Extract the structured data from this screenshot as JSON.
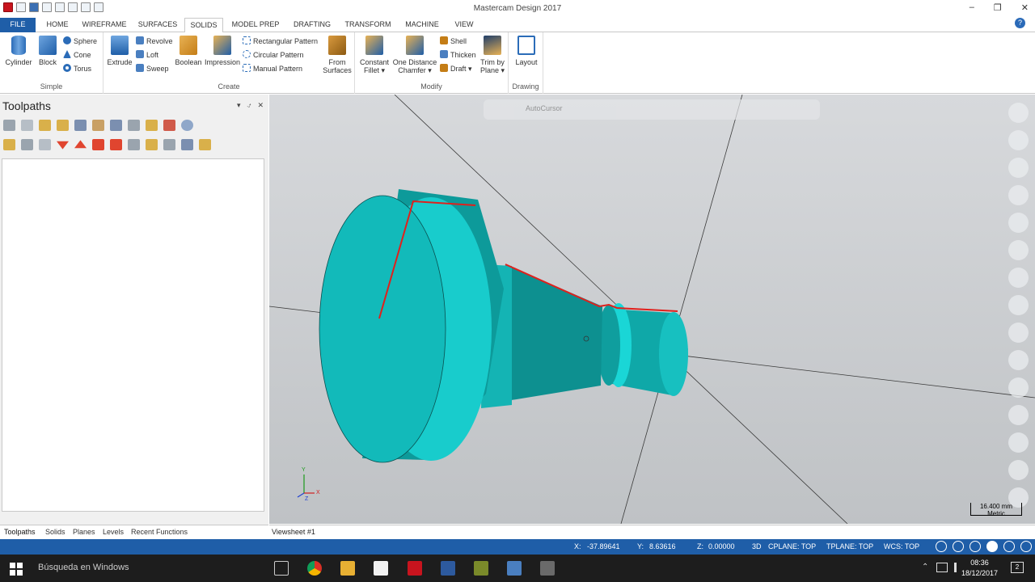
{
  "window": {
    "title": "Mastercam Design 2017"
  },
  "ribbon_tabs": [
    "FILE",
    "HOME",
    "WIREFRAME",
    "SURFACES",
    "SOLIDS",
    "MODEL PREP",
    "DRAFTING",
    "TRANSFORM",
    "MACHINE",
    "VIEW"
  ],
  "ribbon": {
    "simple": {
      "label": "Simple",
      "cylinder": "Cylinder",
      "block": "Block",
      "sphere": "Sphere",
      "cone": "Cone",
      "torus": "Torus"
    },
    "create": {
      "label": "Create",
      "extrude": "Extrude",
      "revolve": "Revolve",
      "loft": "Loft",
      "sweep": "Sweep",
      "boolean": "Boolean",
      "impression": "Impression",
      "rect_pattern": "Rectangular Pattern",
      "circ_pattern": "Circular Pattern",
      "manual_pattern": "Manual Pattern",
      "from_surfaces_1": "From",
      "from_surfaces_2": "Surfaces"
    },
    "modify": {
      "label": "Modify",
      "constant_fillet_1": "Constant",
      "constant_fillet_2": "Fillet",
      "one_distance_1": "One Distance",
      "one_distance_2": "Chamfer",
      "shell": "Shell",
      "thicken": "Thicken",
      "draft": "Draft",
      "trim_1": "Trim by",
      "trim_2": "Plane"
    },
    "drawing": {
      "label": "Drawing",
      "layout": "Layout"
    }
  },
  "toolpaths_panel": {
    "title": "Toolpaths"
  },
  "bottom_tabs": [
    "Toolpaths",
    "Solids",
    "Planes",
    "Levels",
    "Recent Functions"
  ],
  "viewsheet": "Viewsheet #1",
  "viewport": {
    "autocursor": "AutoCursor",
    "scale_value": "16.400 mm",
    "scale_unit": "Metric",
    "axis_y": "Y",
    "axis_x": "X",
    "axis_z": "Z"
  },
  "status": {
    "x_label": "X:",
    "x": "-37.89641",
    "y_label": "Y:",
    "y": "8.63616",
    "z_label": "Z:",
    "z": "0.00000",
    "mode": "3D",
    "cplane": "CPLANE: TOP",
    "tplane": "TPLANE: TOP",
    "wcs": "WCS: TOP"
  },
  "taskbar": {
    "search": "Búsqueda en Windows",
    "time": "08:36",
    "date": "18/12/2017",
    "notifications": "2"
  },
  "colors": {
    "accent": "#1f5ea8",
    "part": "#14c8c8",
    "edge": "#e0201c"
  }
}
